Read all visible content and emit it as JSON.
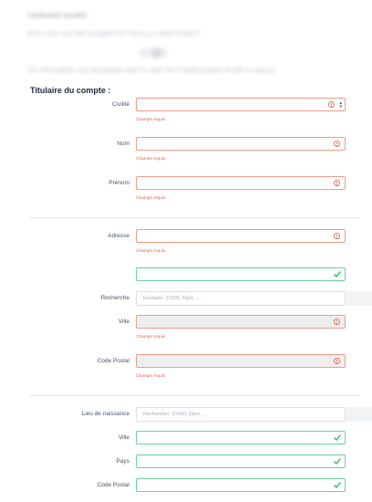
{
  "blurred_header": {
    "title": "Conformité fiscalité",
    "question": "Est-ce que vous êtes assujetti à la TVA ou au crédit d'impôt ?",
    "note": "Ces informations sont demandées dans le cadre de la réglementation fiscale en vigueur."
  },
  "section_title": "Titulaire du compte :",
  "fields": {
    "civilite": {
      "label": "Civilité",
      "error": "Champs requis"
    },
    "nom": {
      "label": "Nom",
      "error": "Champs requis"
    },
    "prenom": {
      "label": "Prénom",
      "error": "Champs requis"
    },
    "adresse": {
      "label": "Adresse",
      "error": "Champs requis"
    },
    "complement": {
      "label": ""
    },
    "recherche": {
      "label": "Recherche",
      "placeholder": "Exemple: 21000, Dijon, ..."
    },
    "ville": {
      "label": "Ville",
      "error": "Champs requis"
    },
    "code_postal": {
      "label": "Code Postal",
      "error": "Champs requis"
    },
    "lieu_naissance": {
      "label": "Lieu de naissance",
      "placeholder": "Rechercher: 21000, Dijon, ..."
    },
    "ville_naissance": {
      "label": "Ville"
    },
    "pays": {
      "label": "Pays"
    },
    "code_postal_naissance": {
      "label": "Code Postal"
    }
  },
  "colors": {
    "error": "#ef9b89",
    "valid": "#69d39e",
    "disabled": "#eeeeee"
  }
}
